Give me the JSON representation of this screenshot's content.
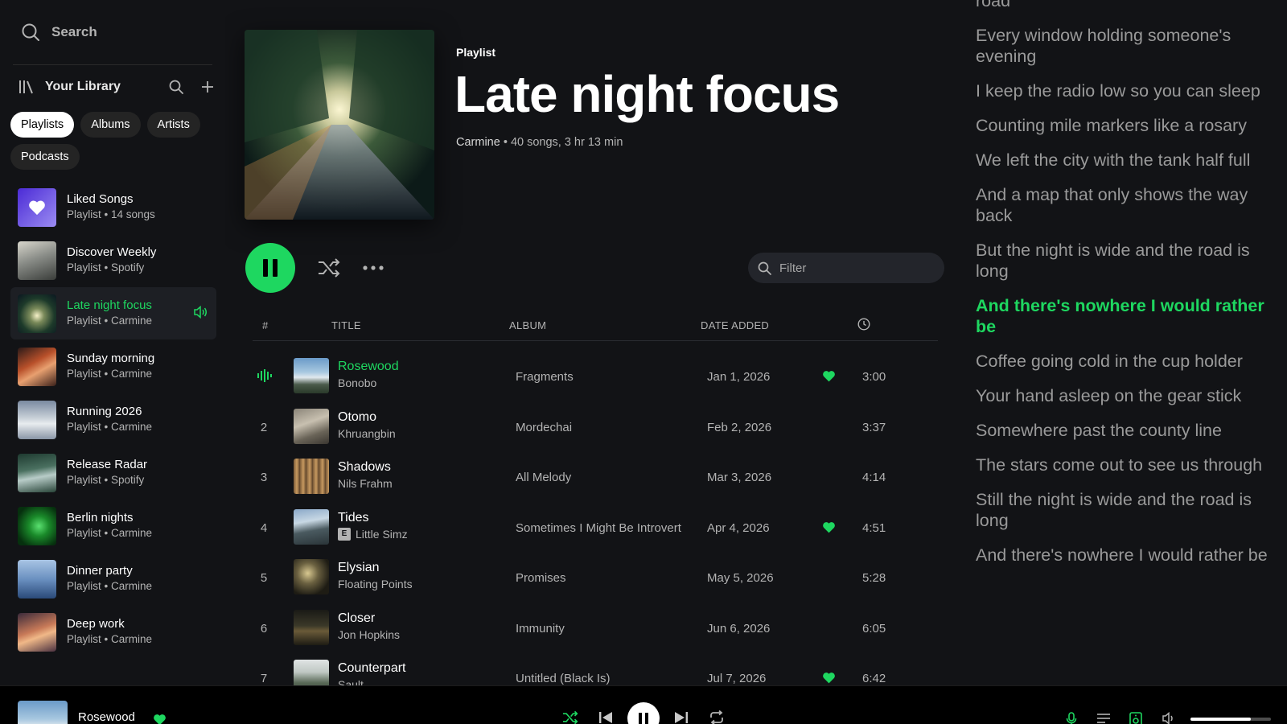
{
  "sidebar": {
    "search_label": "Search",
    "library_title": "Your Library",
    "chips": [
      "Playlists",
      "Albums",
      "Artists",
      "Podcasts"
    ],
    "items": [
      {
        "name": "Liked Songs",
        "sub": "Playlist • 14 songs"
      },
      {
        "name": "Discover Weekly",
        "sub": "Playlist • Spotify"
      },
      {
        "name": "Late night focus",
        "sub": "Playlist • Carmine"
      },
      {
        "name": "Sunday morning",
        "sub": "Playlist • Carmine"
      },
      {
        "name": "Running 2026",
        "sub": "Playlist • Carmine"
      },
      {
        "name": "Release Radar",
        "sub": "Playlist • Spotify"
      },
      {
        "name": "Berlin nights",
        "sub": "Playlist • Carmine"
      },
      {
        "name": "Dinner party",
        "sub": "Playlist • Carmine"
      },
      {
        "name": "Deep work",
        "sub": "Playlist • Carmine"
      }
    ]
  },
  "playlist": {
    "type": "Playlist",
    "title": "Late night focus",
    "owner": "Carmine",
    "stats": "40 songs, 3 hr 13 min",
    "filter_placeholder": "Filter"
  },
  "table": {
    "headers": {
      "num": "#",
      "title": "TITLE",
      "album": "ALBUM",
      "date": "DATE ADDED"
    },
    "rows": [
      {
        "num": "1",
        "title": "Rosewood",
        "artist": "Bonobo",
        "album": "Fragments",
        "date": "Jan 1, 2026",
        "duration": "3:00",
        "liked": true,
        "playing": true,
        "explicit": false
      },
      {
        "num": "2",
        "title": "Otomo",
        "artist": "Khruangbin",
        "album": "Mordechai",
        "date": "Feb 2, 2026",
        "duration": "3:37",
        "liked": false,
        "playing": false,
        "explicit": false
      },
      {
        "num": "3",
        "title": "Shadows",
        "artist": "Nils Frahm",
        "album": "All Melody",
        "date": "Mar 3, 2026",
        "duration": "4:14",
        "liked": false,
        "playing": false,
        "explicit": false
      },
      {
        "num": "4",
        "title": "Tides",
        "artist": "Little Simz",
        "album": "Sometimes I Might Be Introvert",
        "date": "Apr 4, 2026",
        "duration": "4:51",
        "liked": true,
        "playing": false,
        "explicit": true
      },
      {
        "num": "5",
        "title": "Elysian",
        "artist": "Floating Points",
        "album": "Promises",
        "date": "May 5, 2026",
        "duration": "5:28",
        "liked": false,
        "playing": false,
        "explicit": false
      },
      {
        "num": "6",
        "title": "Closer",
        "artist": "Jon Hopkins",
        "album": "Immunity",
        "date": "Jun 6, 2026",
        "duration": "6:05",
        "liked": false,
        "playing": false,
        "explicit": false
      },
      {
        "num": "7",
        "title": "Counterpart",
        "artist": "Sault",
        "album": "Untitled (Black Is)",
        "date": "Jul 7, 2026",
        "duration": "6:42",
        "liked": true,
        "playing": false,
        "explicit": false
      }
    ]
  },
  "lyrics": {
    "current_index": 7,
    "lines": [
      "road",
      "Every window holding someone's evening",
      "I keep the radio low so you can sleep",
      "Counting mile markers like a rosary",
      "We left the city with the tank half full",
      "And a map that only shows the way back",
      "But the night is wide and the road is long",
      "And there's nowhere I would rather be",
      "Coffee going cold in the cup holder",
      "Your hand asleep on the gear stick",
      "Somewhere past the county line",
      "The stars come out to see us through",
      "Still the night is wide and the road is long",
      "And there's nowhere I would rather be"
    ]
  },
  "player": {
    "track_title": "Rosewood"
  },
  "colors": {
    "accent": "#1ed760",
    "background": "#121316",
    "text_secondary": "#b3b3b3"
  }
}
